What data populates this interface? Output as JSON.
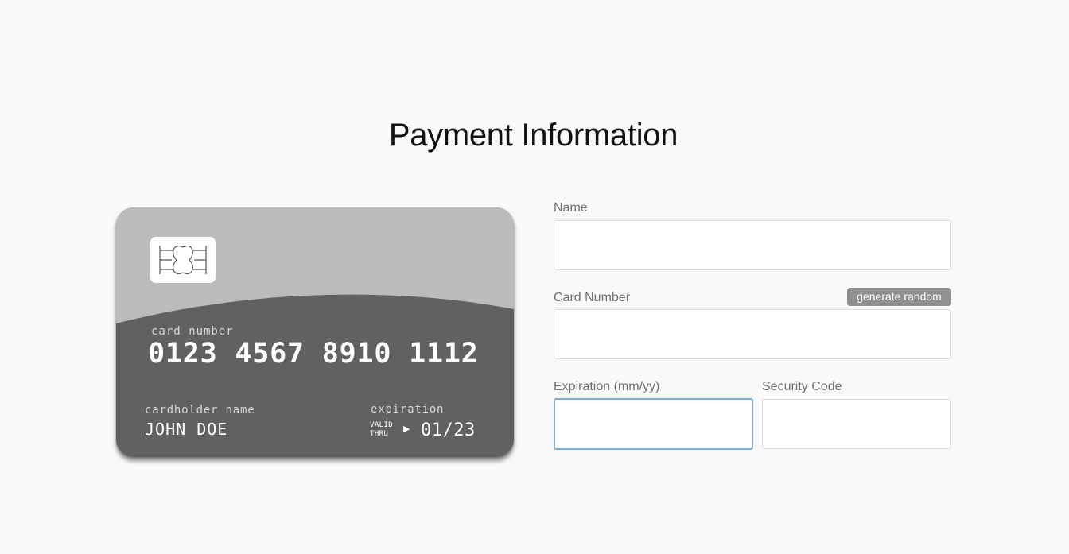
{
  "page": {
    "title": "Payment Information"
  },
  "card": {
    "card_number_label": "card number",
    "card_number": "0123 4567 8910 1112",
    "cardholder_label": "cardholder name",
    "cardholder_name": "JOHN DOE",
    "expiration_label": "expiration",
    "valid_thru_line1": "VALID",
    "valid_thru_line2": "THRU",
    "arrow": "▶",
    "expiration": "01/23",
    "colors": {
      "top": "#bbbbbb",
      "bottom": "#616161",
      "chip": "#ffffff"
    }
  },
  "form": {
    "name": {
      "label": "Name",
      "value": "",
      "placeholder": ""
    },
    "card_number": {
      "label": "Card Number",
      "value": "",
      "placeholder": ""
    },
    "generate_button": "generate random",
    "expiration": {
      "label": "Expiration (mm/yy)",
      "value": "",
      "placeholder": "",
      "focused": true
    },
    "security_code": {
      "label": "Security Code",
      "value": "",
      "placeholder": ""
    }
  },
  "colors": {
    "background": "#f9f9f9",
    "label": "#707070",
    "focus_border": "#80acd9",
    "button": "#909090"
  }
}
